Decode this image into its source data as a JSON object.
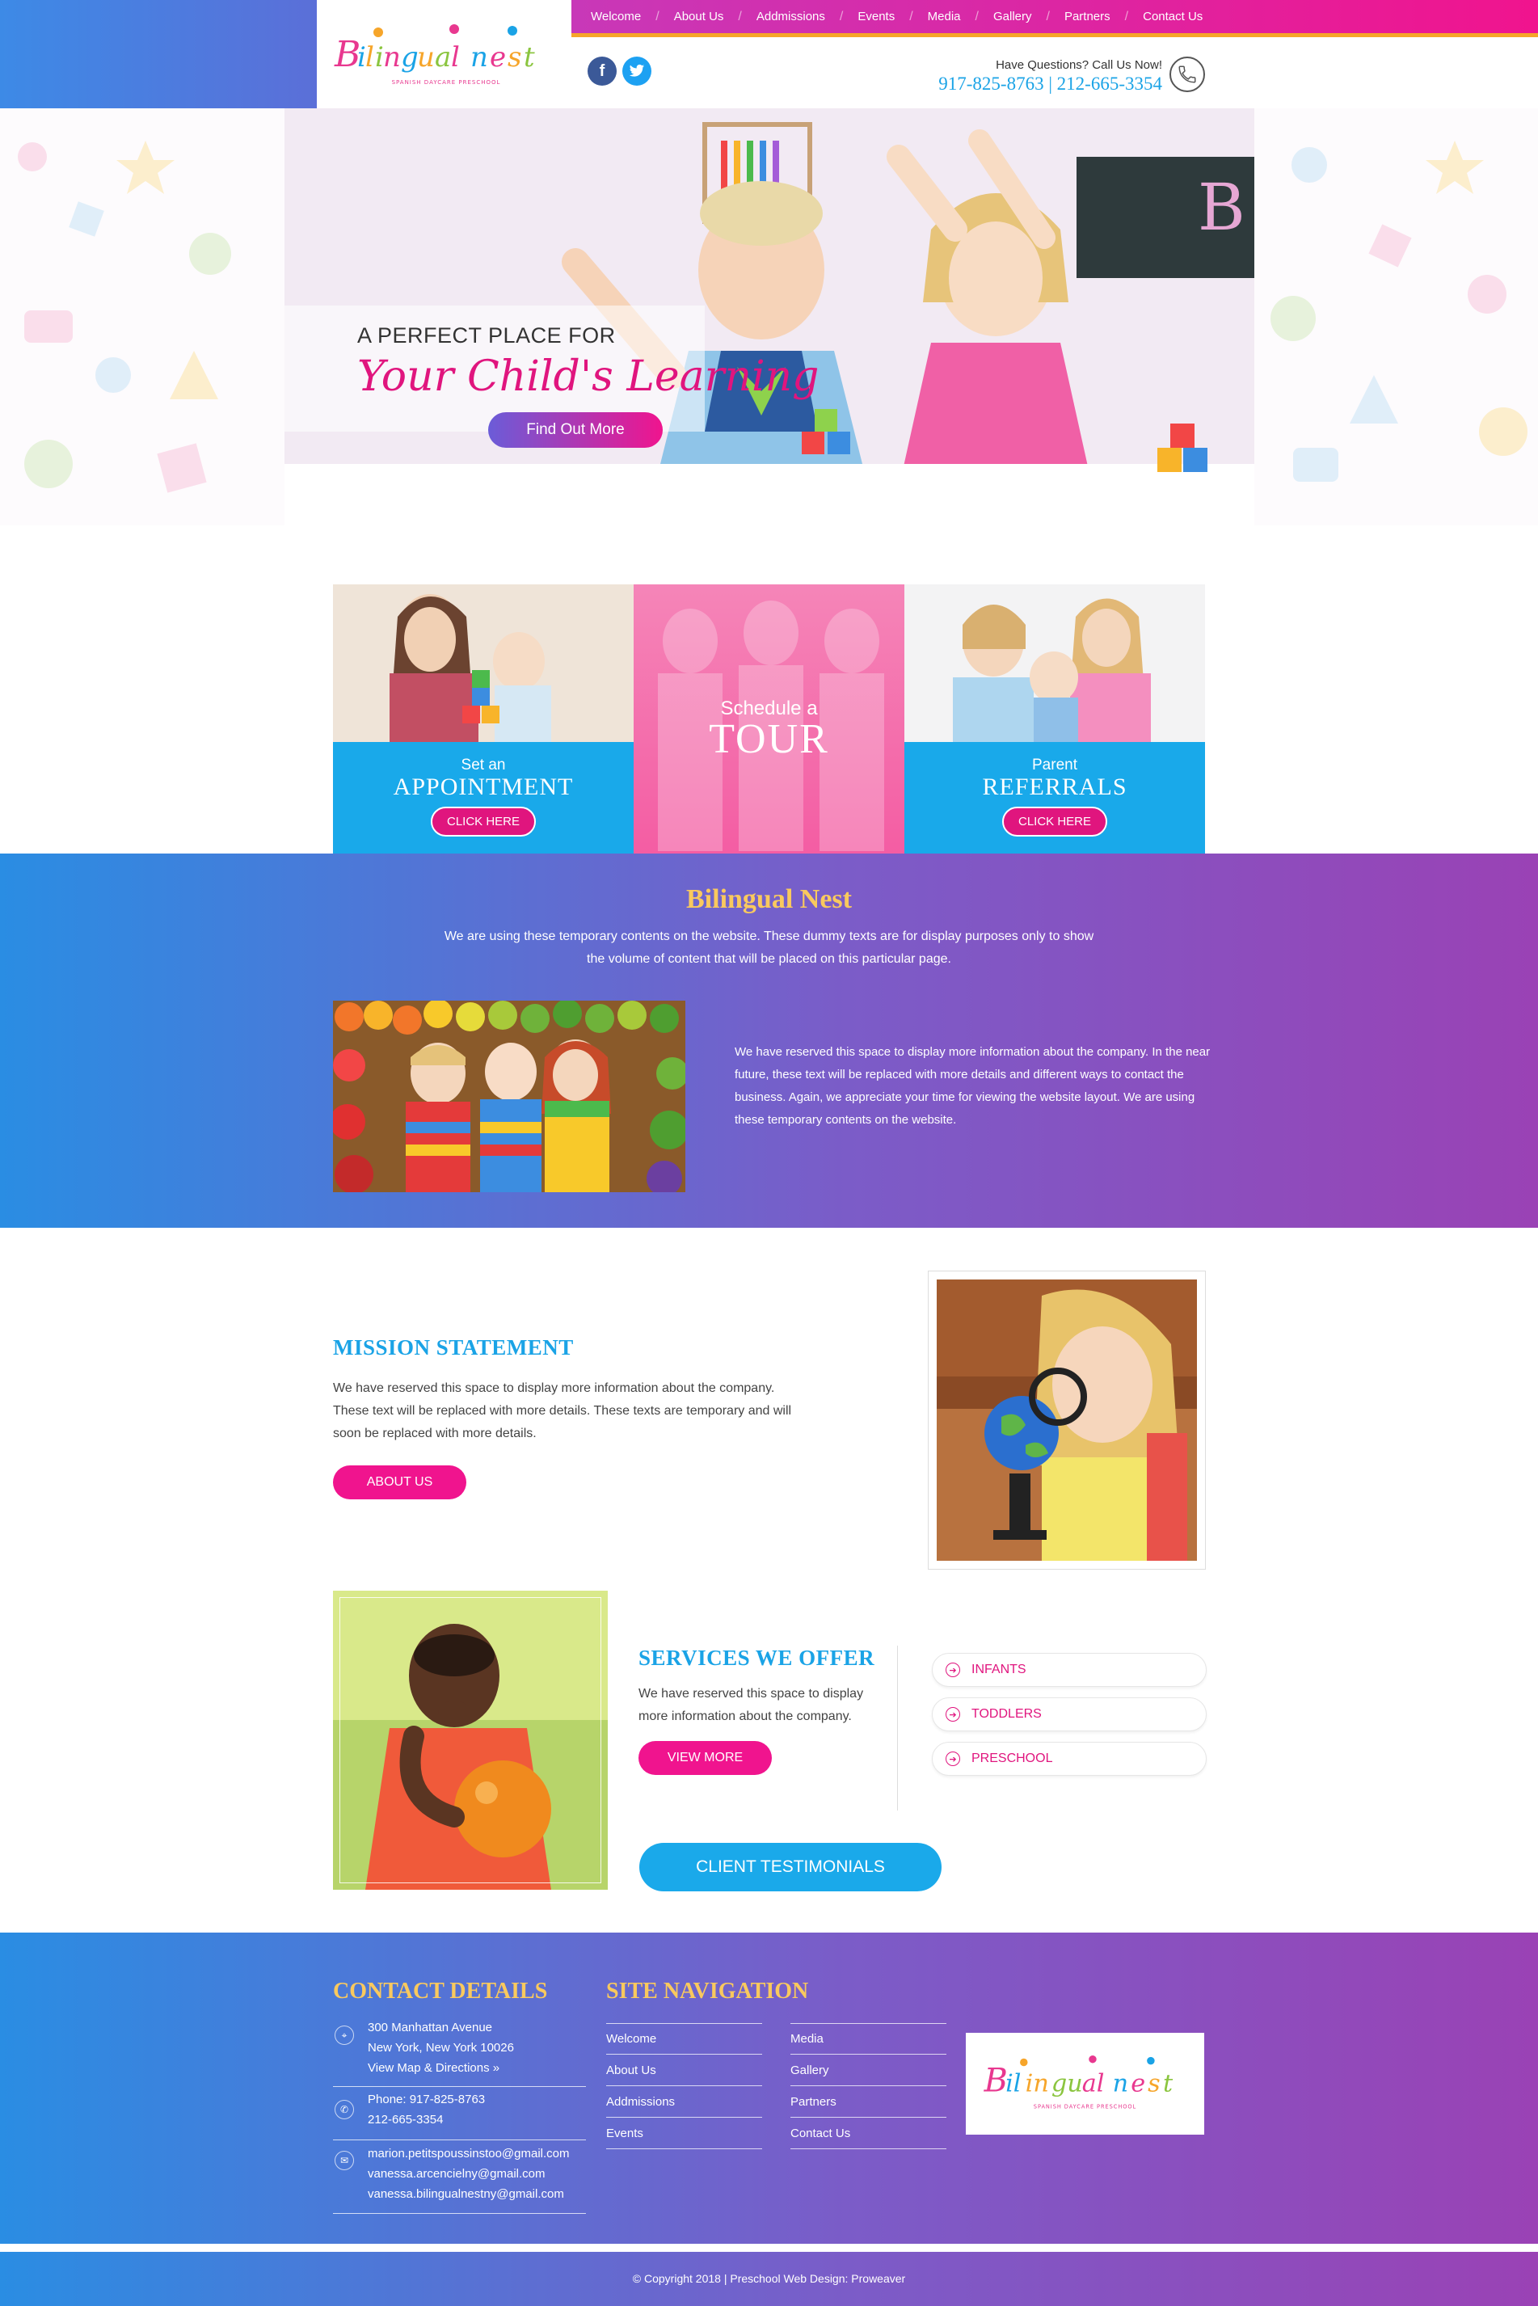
{
  "brand": {
    "logo_text": "Bilingual nest",
    "logo_tagline": "SPANISH DAYCARE PRESCHOOL",
    "accent_pink": "#f0148e",
    "accent_blue": "#1aa3e6",
    "accent_gold": "#f9c95e"
  },
  "nav": {
    "items": [
      "Welcome",
      "About Us",
      "Addmissions",
      "Events",
      "Media",
      "Gallery",
      "Partners",
      "Contact Us"
    ]
  },
  "header": {
    "social": {
      "facebook_icon": "facebook-icon",
      "twitter_icon": "twitter-icon"
    },
    "question": "Have Questions? Call Us Now!",
    "phones": "917-825-8763 | 212-665-3354"
  },
  "hero": {
    "line1": "A PERFECT PLACE FOR",
    "line2": "Your Child's Learning",
    "cta": "Find Out More"
  },
  "cards": {
    "appointment": {
      "small": "Set an",
      "big": "APPOINTMENT",
      "button": "CLICK HERE"
    },
    "tour": {
      "small": "Schedule a",
      "big": "TOUR"
    },
    "referrals": {
      "small": "Parent",
      "big": "REFERRALS",
      "button": "CLICK HERE"
    }
  },
  "about": {
    "title": "Bilingual Nest",
    "intro": "We are using these temporary contents on the website. These dummy texts are for display purposes only to show the volume of content that will be placed on this particular page.",
    "body": "We have reserved this space to display more information about the company. In the near future, these text will be replaced with more details and different ways to contact the business. Again, we appreciate your time for viewing the website layout. We are using these temporary contents on the website."
  },
  "mission": {
    "title": "MISSION STATEMENT",
    "body": "We have reserved this space to display more information about the company. These text will be replaced with more details. These texts are temporary and will soon be replaced with more details.",
    "button": "ABOUT US"
  },
  "services": {
    "title": "SERVICES WE OFFER",
    "body": "We have reserved this space to display more information about the company.",
    "button": "VIEW MORE",
    "programs": [
      "INFANTS",
      "TODDLERS",
      "PRESCHOOL"
    ],
    "testimonials": "CLIENT TESTIMONIALS"
  },
  "footer": {
    "contact_heading": "CONTACT DETAILS",
    "address": [
      "300 Manhattan Avenue",
      "New York, New York 10026",
      "View Map & Directions »"
    ],
    "phone": [
      "Phone: 917-825-8763",
      "212-665-3354"
    ],
    "emails": [
      "marion.petitspoussinstoo@gmail.com",
      "vanessa.arcencielny@gmail.com",
      "vanessa.bilingualnestny@gmail.com"
    ],
    "nav_heading": "SITE NAVIGATION",
    "nav_col1": [
      "Welcome",
      "About Us",
      "Addmissions",
      "Events"
    ],
    "nav_col2": [
      "Media",
      "Gallery",
      "Partners",
      "Contact Us"
    ],
    "copyright": "© Copyright 2018  |  Preschool Web Design: Proweaver"
  }
}
